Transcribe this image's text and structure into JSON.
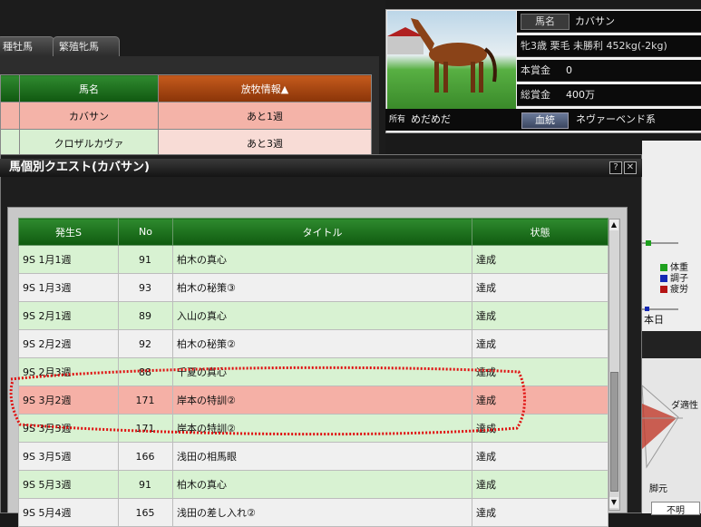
{
  "background_window": {
    "tabs": [
      "種牡馬",
      "繁殖牝馬"
    ],
    "table": {
      "headers": [
        "馬名",
        "放牧情報▲"
      ],
      "rows": [
        [
          "カバサン",
          "あと1週"
        ],
        [
          "クロザルカヴァ",
          "あと3週"
        ]
      ]
    }
  },
  "horse_info": {
    "name_label": "馬名",
    "name": "カバサン",
    "profile": "牝3歳 栗毛 未勝利 452kg(-2kg)",
    "prize_label": "本賞金",
    "prize": "0",
    "total_prize_label": "総賞金",
    "total_prize": "400万",
    "owner_label": "所有",
    "owner": "めだめだ",
    "bloodline_button": "血統",
    "bloodline": "ネヴァーベンド系"
  },
  "quest_window": {
    "title": "馬個別クエスト(カバサン)",
    "help_button": "?",
    "close_button": "✕",
    "columns": [
      "発生S",
      "No",
      "タイトル",
      "状態"
    ],
    "rows": [
      {
        "when": "9S 1月1週",
        "no": "91",
        "title": "柏木の真心",
        "status": "達成",
        "style": "g"
      },
      {
        "when": "9S 1月3週",
        "no": "93",
        "title": "柏木の秘策③",
        "status": "達成",
        "style": "w"
      },
      {
        "when": "9S 2月1週",
        "no": "89",
        "title": "入山の真心",
        "status": "達成",
        "style": "g"
      },
      {
        "when": "9S 2月2週",
        "no": "92",
        "title": "柏木の秘策②",
        "status": "達成",
        "style": "w"
      },
      {
        "when": "9S 2月3週",
        "no": "88",
        "title": "千夏の真心",
        "status": "達成",
        "style": "g"
      },
      {
        "when": "9S 3月2週",
        "no": "171",
        "title": "岸本の特訓②",
        "status": "達成",
        "style": "p"
      },
      {
        "when": "9S 3月3週",
        "no": "171",
        "title": "岸本の特訓②",
        "status": "達成",
        "style": "g"
      },
      {
        "when": "9S 3月5週",
        "no": "166",
        "title": "浅田の相馬眼",
        "status": "達成",
        "style": "w"
      },
      {
        "when": "9S 5月3週",
        "no": "91",
        "title": "柏木の真心",
        "status": "達成",
        "style": "g"
      },
      {
        "when": "9S 5月4週",
        "no": "165",
        "title": "浅田の差し入れ②",
        "status": "達成",
        "style": "w"
      }
    ]
  },
  "right_panel": {
    "legend": [
      {
        "label": "体重",
        "color": "#1ea01e"
      },
      {
        "label": "調子",
        "color": "#1428b4"
      },
      {
        "label": "疲労",
        "color": "#b41414"
      }
    ],
    "today_label": "本日",
    "aptitude_label": "ダ適性",
    "kyaku_label": "脚元",
    "unknown_label": "不明"
  },
  "annotation_color": "#e01010"
}
